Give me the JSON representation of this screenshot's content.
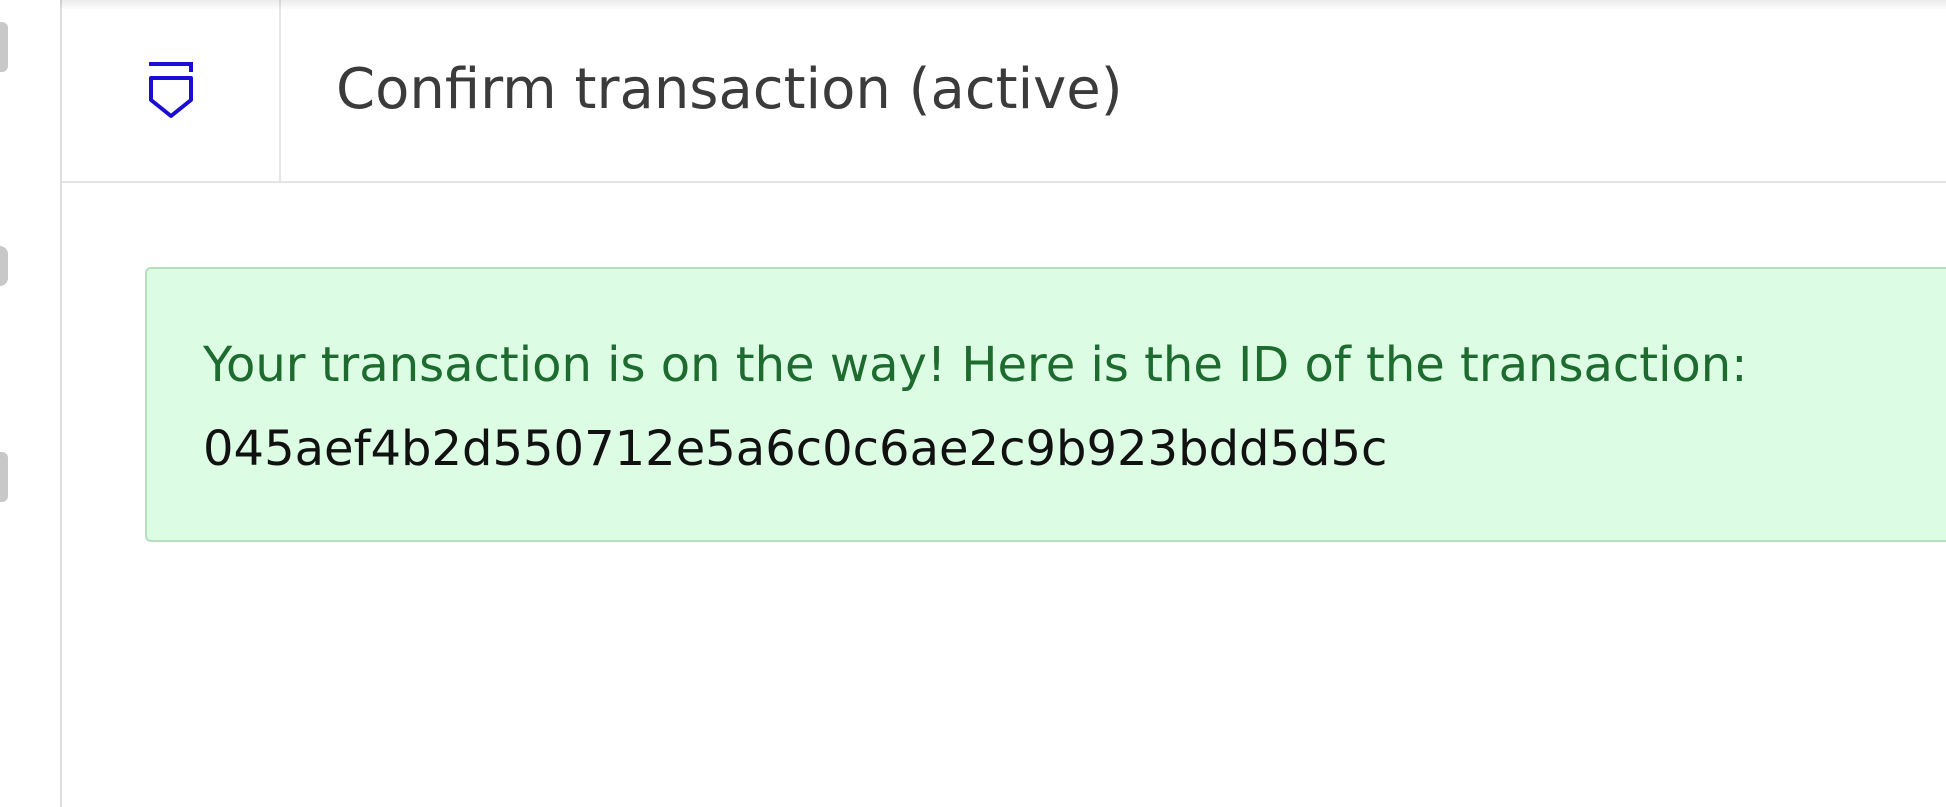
{
  "header": {
    "title": "Confirm transaction (active)",
    "logo_icon": "shield-icon",
    "logo_color": "#1a0dd6"
  },
  "alert": {
    "message": "Your transaction is on the way! Here is the ID of the transaction:",
    "transaction_id": "045aef4b2d550712e5a6c0c6ae2c9b923bdd5d5c",
    "background_color": "#dcfce4",
    "text_color": "#1d6b2f"
  }
}
